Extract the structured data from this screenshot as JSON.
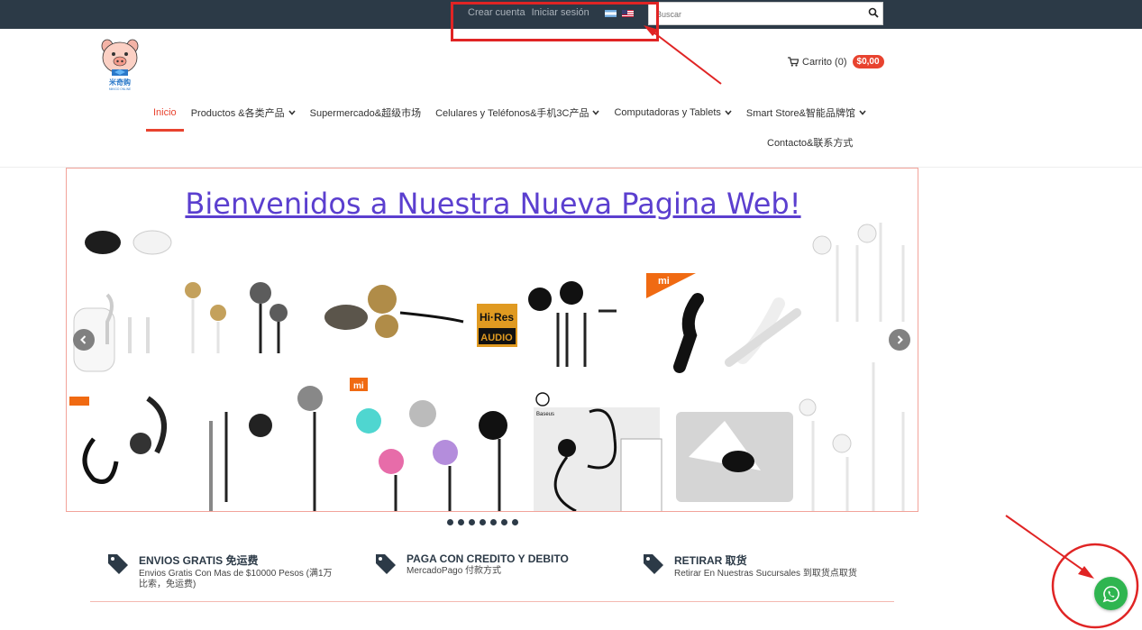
{
  "header": {
    "create_account": "Crear cuenta",
    "login": "Iniciar sesión",
    "search_placeholder": "Buscar"
  },
  "logo": {
    "text": "米奇购",
    "subtext": "MIKIGO ONLINE"
  },
  "cart": {
    "label": "Carrito (0)",
    "total": "$0,00"
  },
  "nav": {
    "items": [
      {
        "label": "Inicio",
        "active": true
      },
      {
        "label": "Productos &各类产品",
        "dropdown": true
      },
      {
        "label": "Supermercado&超级市场"
      },
      {
        "label": "Celulares y Teléfonos&手机3C产品",
        "dropdown": true
      },
      {
        "label": "Computadoras y Tablets",
        "dropdown": true
      },
      {
        "label": "Smart Store&智能品牌馆",
        "dropdown": true
      }
    ],
    "contact": "Contacto&联系方式"
  },
  "banner": {
    "title": "Bienvenidos a Nuestra Nueva Pagina Web!",
    "badge_hires_top": "Hi·Res",
    "badge_hires_bottom": "AUDIO",
    "badge_mi": "mi",
    "badge_baseus": "Baseus",
    "slide_count": 7
  },
  "features": [
    {
      "title": "ENVIOS GRATIS 免运费",
      "desc": "Envios Gratis Con Mas de $10000 Pesos (满1万比索，免运费)"
    },
    {
      "title": "PAGA CON CREDITO Y DEBITO",
      "desc": "MercadoPago 付款方式"
    },
    {
      "title": "RETIRAR 取货",
      "desc": "Retirar En Nuestras Sucursales 到取货点取货"
    }
  ],
  "colors": {
    "topbar": "#2c3a47",
    "accent": "#e8432f",
    "banner_title": "#5b3fcf",
    "whatsapp": "#2fb550",
    "annotation": "#e02424"
  }
}
